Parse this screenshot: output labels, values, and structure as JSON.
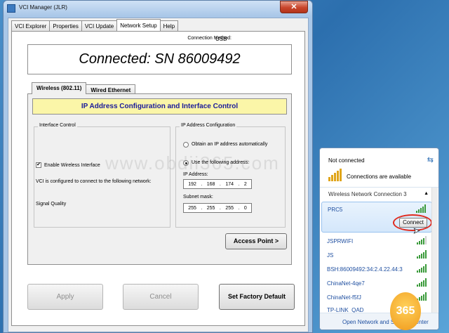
{
  "window": {
    "title": "VCI Manager (JLR)"
  },
  "tabs": [
    "VCI Explorer",
    "Properties",
    "VCI Update",
    "Network Setup",
    "Help"
  ],
  "connection": {
    "method_label": "Connection Method:",
    "method_value": "USB",
    "status": "Connected: SN 86009492"
  },
  "inner_tabs": [
    "Wireless (802.11)",
    "Wired Ethernet"
  ],
  "banner": "IP Address Configuration and Interface Control",
  "interface_control": {
    "group_label": "Interface Control",
    "enable_label": "Enable Wireless Interface",
    "enable_checked": true,
    "configured_text": "VCI is configured to connect to the following network:",
    "signal_label": "Signal Quality"
  },
  "ip_config": {
    "group_label": "IP Address Configuration",
    "auto_label": "Obtain an IP address automatically",
    "manual_label": "Use the following address:",
    "ip_label": "IP Address:",
    "ip": [
      "192",
      "168",
      "174",
      "2"
    ],
    "mask_label": "Subnet mask:",
    "mask": [
      "255",
      "255",
      "255",
      "0"
    ]
  },
  "buttons": {
    "access_point": "Access Point >",
    "apply": "Apply",
    "cancel": "Cancel",
    "factory": "Set Factory Default"
  },
  "flyout": {
    "status": "Not connected",
    "available": "Connections are available",
    "section": "Wireless Network Connection 3",
    "networks": [
      "PRC5",
      "JSPRWIFI",
      "JS",
      "BSH:86009492:34:2.4.22.44:3",
      "ChinaNet-4qe7",
      "ChinaNet-f5fJ",
      "TP-LINK_QAD"
    ],
    "connect_label": "Connect",
    "footer": "Open Network and Sharing Center"
  },
  "watermark": "www.obdii365.com",
  "logo_text": "365"
}
